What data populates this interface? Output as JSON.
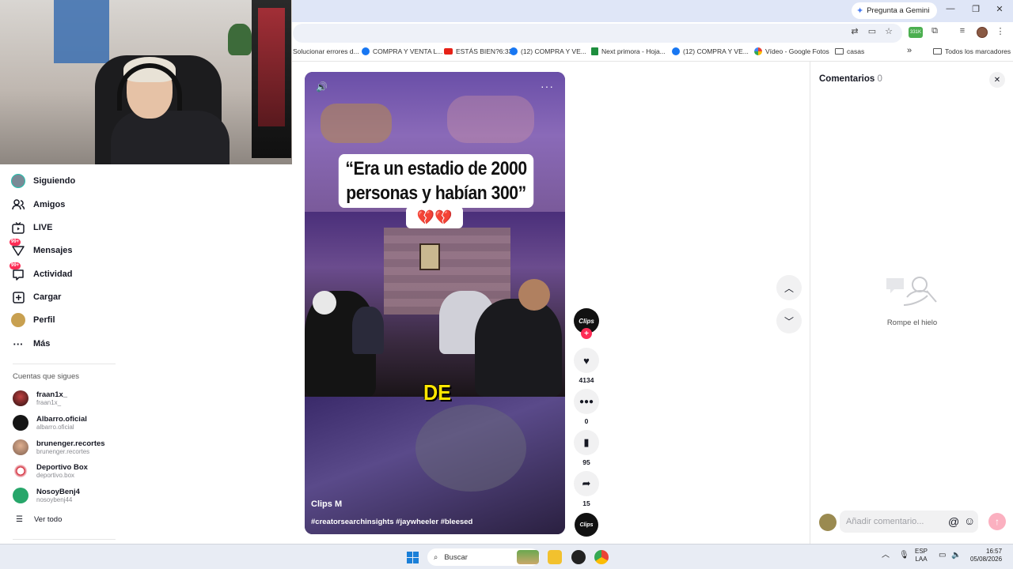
{
  "browser": {
    "gemini_label": "Pregunta a Gemini",
    "ext_badge": "331K",
    "bookmarks": [
      {
        "label": "Solucionar errores d..."
      },
      {
        "label": "COMPRA Y VENTA L..."
      },
      {
        "label": "ESTÁS BIEN?6:33"
      },
      {
        "label": "(12) COMPRA Y VE..."
      },
      {
        "label": "Next primora - Hoja..."
      },
      {
        "label": "(12) COMPRA Y VE..."
      },
      {
        "label": "Vídeo - Google Fotos"
      },
      {
        "label": "casas"
      }
    ],
    "bookmarks_overflow": "»",
    "all_bookmarks": "Todos los marcadores"
  },
  "sidebar": {
    "items": [
      {
        "label": "Siguiendo",
        "icon": "avatar"
      },
      {
        "label": "Amigos",
        "icon": "friends-icon"
      },
      {
        "label": "LIVE",
        "icon": "live-icon"
      },
      {
        "label": "Mensajes",
        "icon": "messages-icon",
        "badge": "99+"
      },
      {
        "label": "Actividad",
        "icon": "activity-icon",
        "badge": "99+"
      },
      {
        "label": "Cargar",
        "icon": "upload-icon"
      },
      {
        "label": "Perfil",
        "icon": "avatar"
      },
      {
        "label": "Más",
        "icon": "more-icon"
      }
    ],
    "following_title": "Cuentas que sigues",
    "accounts": [
      {
        "name": "fraan1x_",
        "handle": "fraan1x_"
      },
      {
        "name": "Albarro.oficial",
        "handle": "albarro.oficial"
      },
      {
        "name": "brunenger.recortes",
        "handle": "brunenger.recortes"
      },
      {
        "name": "Deportivo Box",
        "handle": "deportivo.box"
      },
      {
        "name": "NosoyBenj4",
        "handle": "nosoybenj44"
      }
    ],
    "see_all": "Ver todo"
  },
  "video": {
    "caption_line1": "“Era un estadio de 2000",
    "caption_line2": "personas y habían 300”",
    "caption_emoji": "💔💔",
    "subtitle_word": "DE",
    "author": "Clips M",
    "hashtags": "#creatorsearchinsights #jaywheeler #bleesed",
    "creator_avatar_text": "Clips"
  },
  "actions": {
    "likes": "4134",
    "comments": "0",
    "saves": "95",
    "shares": "15",
    "follow_plus": "+"
  },
  "comments_panel": {
    "title": "Comentarios",
    "count": "0",
    "empty_text": "Rompe el hielo",
    "input_placeholder": "Añadir comentario..."
  },
  "taskbar": {
    "search_label": "Buscar",
    "lang_top": "ESP",
    "lang_bottom": "LAA",
    "time": "16:57",
    "date": "05/08/2026"
  }
}
